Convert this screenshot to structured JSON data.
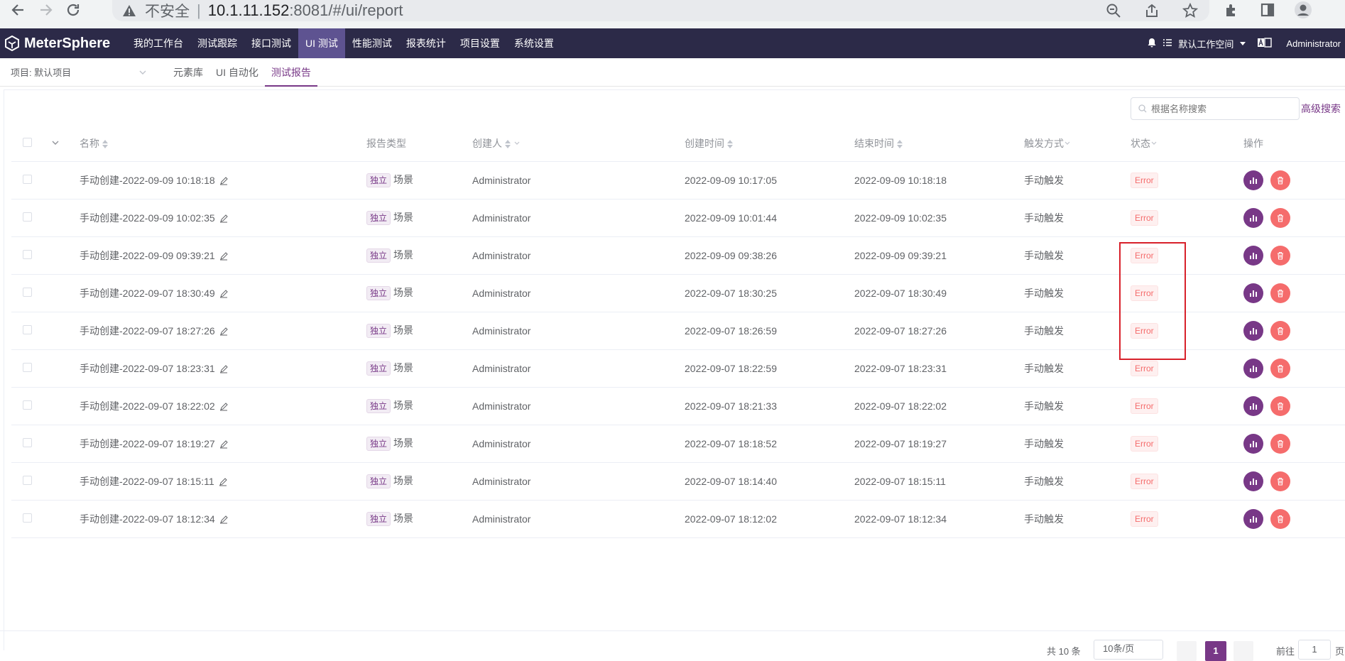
{
  "browser": {
    "insecure_label": "不安全",
    "url_host": "10.1.11.152",
    "url_path": ":8081/#/ui/report"
  },
  "app": {
    "logo": "MeterSphere",
    "nav": [
      {
        "label": "我的工作台"
      },
      {
        "label": "测试跟踪"
      },
      {
        "label": "接口测试"
      },
      {
        "label": "UI 测试"
      },
      {
        "label": "性能测试"
      },
      {
        "label": "报表统计"
      },
      {
        "label": "项目设置"
      },
      {
        "label": "系统设置"
      }
    ],
    "workspace": "默认工作空间",
    "user": "Administrator"
  },
  "sub": {
    "project": "项目: 默认项目",
    "tabs": [
      {
        "label": "元素库"
      },
      {
        "label": "UI 自动化"
      },
      {
        "label": "测试报告"
      }
    ]
  },
  "search": {
    "placeholder": "根据名称搜索",
    "advanced": "高级搜索"
  },
  "table": {
    "headers": {
      "name": "名称",
      "type": "报告类型",
      "creator": "创建人",
      "create_time": "创建时间",
      "end_time": "结束时间",
      "trigger": "触发方式",
      "status": "状态",
      "ops": "操作"
    },
    "rows": [
      {
        "name": "手动创建-2022-09-09 10:18:18",
        "tag": "独立",
        "type": "场景",
        "creator": "Administrator",
        "create_time": "2022-09-09 10:17:05",
        "end_time": "2022-09-09 10:18:18",
        "trigger": "手动触发",
        "status": "Error"
      },
      {
        "name": "手动创建-2022-09-09 10:02:35",
        "tag": "独立",
        "type": "场景",
        "creator": "Administrator",
        "create_time": "2022-09-09 10:01:44",
        "end_time": "2022-09-09 10:02:35",
        "trigger": "手动触发",
        "status": "Error"
      },
      {
        "name": "手动创建-2022-09-09 09:39:21",
        "tag": "独立",
        "type": "场景",
        "creator": "Administrator",
        "create_time": "2022-09-09 09:38:26",
        "end_time": "2022-09-09 09:39:21",
        "trigger": "手动触发",
        "status": "Error"
      },
      {
        "name": "手动创建-2022-09-07 18:30:49",
        "tag": "独立",
        "type": "场景",
        "creator": "Administrator",
        "create_time": "2022-09-07 18:30:25",
        "end_time": "2022-09-07 18:30:49",
        "trigger": "手动触发",
        "status": "Error"
      },
      {
        "name": "手动创建-2022-09-07 18:27:26",
        "tag": "独立",
        "type": "场景",
        "creator": "Administrator",
        "create_time": "2022-09-07 18:26:59",
        "end_time": "2022-09-07 18:27:26",
        "trigger": "手动触发",
        "status": "Error"
      },
      {
        "name": "手动创建-2022-09-07 18:23:31",
        "tag": "独立",
        "type": "场景",
        "creator": "Administrator",
        "create_time": "2022-09-07 18:22:59",
        "end_time": "2022-09-07 18:23:31",
        "trigger": "手动触发",
        "status": "Error"
      },
      {
        "name": "手动创建-2022-09-07 18:22:02",
        "tag": "独立",
        "type": "场景",
        "creator": "Administrator",
        "create_time": "2022-09-07 18:21:33",
        "end_time": "2022-09-07 18:22:02",
        "trigger": "手动触发",
        "status": "Error"
      },
      {
        "name": "手动创建-2022-09-07 18:19:27",
        "tag": "独立",
        "type": "场景",
        "creator": "Administrator",
        "create_time": "2022-09-07 18:18:52",
        "end_time": "2022-09-07 18:19:27",
        "trigger": "手动触发",
        "status": "Error"
      },
      {
        "name": "手动创建-2022-09-07 18:15:11",
        "tag": "独立",
        "type": "场景",
        "creator": "Administrator",
        "create_time": "2022-09-07 18:14:40",
        "end_time": "2022-09-07 18:15:11",
        "trigger": "手动触发",
        "status": "Error"
      },
      {
        "name": "手动创建-2022-09-07 18:12:34",
        "tag": "独立",
        "type": "场景",
        "creator": "Administrator",
        "create_time": "2022-09-07 18:12:02",
        "end_time": "2022-09-07 18:12:34",
        "trigger": "手动触发",
        "status": "Error"
      }
    ]
  },
  "pagination": {
    "total": "共 10 条",
    "page_size": "10条/页",
    "current_page": "1",
    "goto_label": "前往",
    "goto_value": "1",
    "unit": "页"
  },
  "colors": {
    "header_bg": "#2c2a48",
    "accent": "#783887",
    "danger": "#f56c6c"
  }
}
